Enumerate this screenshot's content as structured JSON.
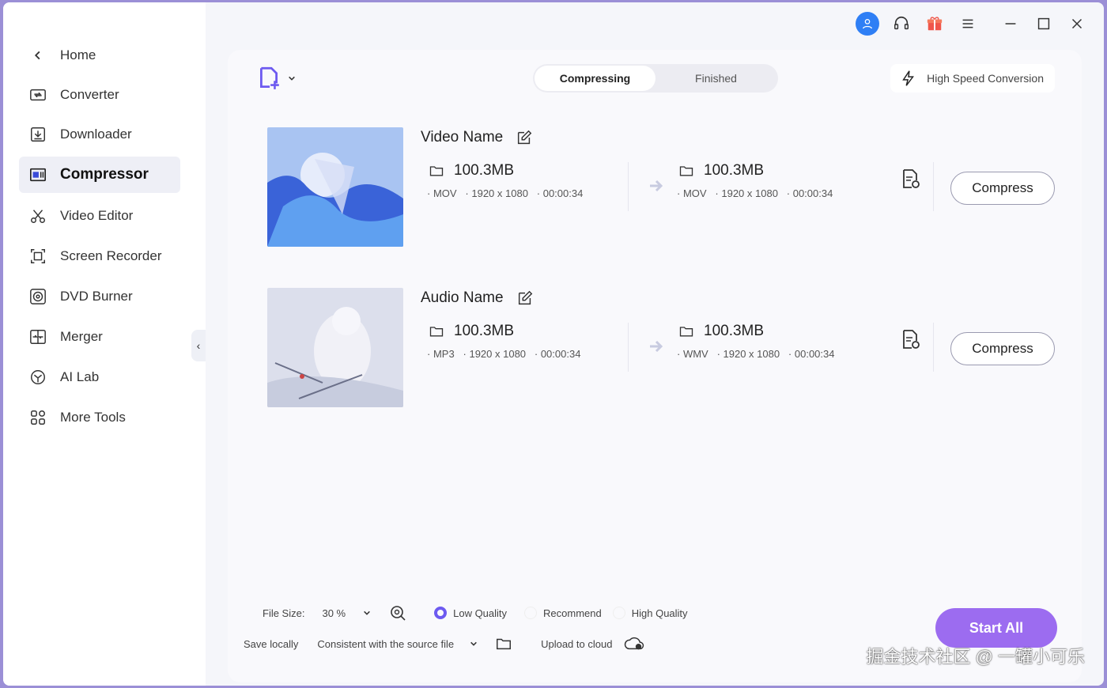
{
  "sidebar": {
    "items": [
      {
        "label": "Home",
        "icon": "chevron-left-icon"
      },
      {
        "label": "Converter",
        "icon": "converter-icon"
      },
      {
        "label": "Downloader",
        "icon": "download-icon"
      },
      {
        "label": "Compressor",
        "icon": "compressor-icon",
        "active": true
      },
      {
        "label": "Video Editor",
        "icon": "scissors-icon"
      },
      {
        "label": "Screen Recorder",
        "icon": "screen-record-icon"
      },
      {
        "label": "DVD Burner",
        "icon": "disc-icon"
      },
      {
        "label": "Merger",
        "icon": "merge-icon"
      },
      {
        "label": "AI Lab",
        "icon": "ai-lab-icon"
      },
      {
        "label": "More Tools",
        "icon": "grid-icon"
      }
    ]
  },
  "tabs": {
    "compressing": "Compressing",
    "finished": "Finished"
  },
  "high_speed": "High Speed Conversion",
  "files": [
    {
      "name": "Video Name",
      "src": {
        "size": "100.3MB",
        "format": "MOV",
        "resolution": "1920 x 1080",
        "duration": "00:00:34"
      },
      "dst": {
        "size": "100.3MB",
        "format": "MOV",
        "resolution": "1920 x 1080",
        "duration": "00:00:34"
      },
      "button": "Compress"
    },
    {
      "name": "Audio Name",
      "src": {
        "size": "100.3MB",
        "format": "MP3",
        "resolution": "1920 x 1080",
        "duration": "00:00:34"
      },
      "dst": {
        "size": "100.3MB",
        "format": "WMV",
        "resolution": "1920 x 1080",
        "duration": "00:00:34"
      },
      "button": "Compress"
    }
  ],
  "bottom": {
    "file_size_label": "File Size:",
    "file_size_value": "30 %",
    "quality": {
      "low": "Low Quality",
      "recommend": "Recommend",
      "high": "High Quality",
      "selected": "low"
    },
    "save_label": "Save locally",
    "save_value": "Consistent with the source file",
    "upload": "Upload to cloud",
    "start_all": "Start All"
  },
  "watermark": "掘金技术社区 @ 一罐小可乐",
  "colors": {
    "accent": "#6d5af0",
    "start_button": "#9c6cf0",
    "avatar": "#2f7ff5",
    "gift": "#f0564a"
  }
}
